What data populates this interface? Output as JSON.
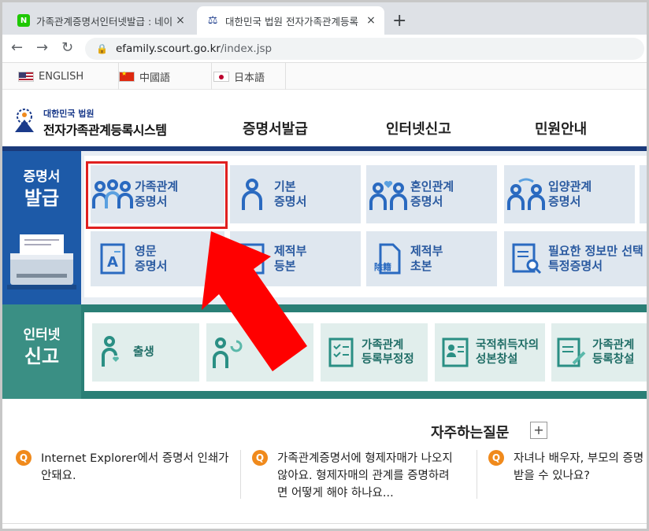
{
  "browser": {
    "tabs": [
      {
        "favicon": "N",
        "title": "가족관계증명서인터넷발급 : 네이",
        "close": "×"
      },
      {
        "favicon": "⚖",
        "title": "대한민국 법원 전자가족관계등록",
        "close": "×"
      }
    ],
    "new_tab": "+",
    "nav": {
      "back": "←",
      "forward": "→",
      "reload": "↻"
    },
    "url_host": "efamily.scourt.go.kr",
    "url_path": "/index.jsp",
    "lock": "🔒"
  },
  "languages": [
    "ENGLISH",
    "中國語",
    "日本語"
  ],
  "header": {
    "logo_sub": "대한민국 법원",
    "logo_main": "전자가족관계등록시스템",
    "gnb": [
      "증명서발급",
      "인터넷신고",
      "민원안내"
    ]
  },
  "cert_section": {
    "side_title_1": "증명서",
    "side_title_2": "발급",
    "cards": [
      {
        "label": "가족관계\n증명서",
        "icon": "family-icon"
      },
      {
        "label": "기본\n증명서",
        "icon": "person-icon"
      },
      {
        "label": "혼인관계\n증명서",
        "icon": "couple-heart-icon"
      },
      {
        "label": "입양관계\n증명서",
        "icon": "adoption-icon"
      },
      {
        "label": "영문\n증명서",
        "icon": "document-a-icon"
      },
      {
        "label": "제적부\n등본",
        "icon": "register-icon"
      },
      {
        "label": "제적부\n초본",
        "icon": "register-icon",
        "badge": "除籍"
      },
      {
        "label": "필요한 정보만 선택\n특정증명서",
        "icon": "document-search-icon"
      }
    ]
  },
  "report_section": {
    "side_title_1": "인터넷",
    "side_title_2": "신고",
    "cards": [
      {
        "label": "출생",
        "icon": "baby-icon"
      },
      {
        "label": "",
        "icon": "person-return-icon"
      },
      {
        "label": "가족관계\n등록부정정",
        "icon": "checklist-icon"
      },
      {
        "label": "국적취득자의\n성본창설",
        "icon": "id-card-icon"
      },
      {
        "label": "가족관계\n등록창설",
        "icon": "document-pen-icon"
      }
    ]
  },
  "faq": {
    "title": "자주하는질문",
    "more": "+",
    "badge": "Q",
    "items": [
      "Internet Explorer에서 증명서 인쇄가\n안돼요.",
      "가족관계증명서에 형제자매가 나오지\n않아요. 형제자매의 관계를 증명하려\n면 어떻게 해야 하나요...",
      "자녀나 배우자, 부모의 증명\n받을 수 있나요?"
    ]
  },
  "colors": {
    "cert_blue": "#1d5aa8",
    "report_teal": "#2a7f76",
    "highlight_red": "#e02020",
    "arrow_red": "#ff0000",
    "faq_orange": "#f08a1c"
  }
}
